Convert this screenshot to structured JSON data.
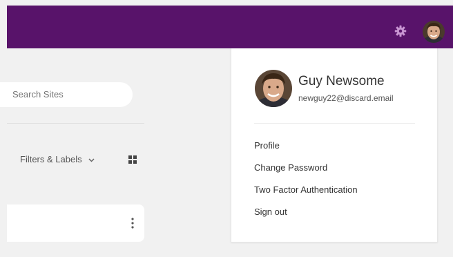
{
  "header": {
    "background_color": "#58136a",
    "icons": [
      "gear-icon",
      "avatar"
    ]
  },
  "sidebar": {
    "search_placeholder": "Search Sites",
    "filters_label": "Filters & Labels",
    "icons": [
      "chevron-down-icon",
      "grid-icon",
      "kebab-menu-icon"
    ]
  },
  "user_menu": {
    "name": "Guy Newsome",
    "email": "newguy22@discard.email",
    "items": [
      {
        "label": "Profile"
      },
      {
        "label": "Change Password"
      },
      {
        "label": "Two Factor Authentication"
      },
      {
        "label": "Sign out"
      }
    ]
  }
}
